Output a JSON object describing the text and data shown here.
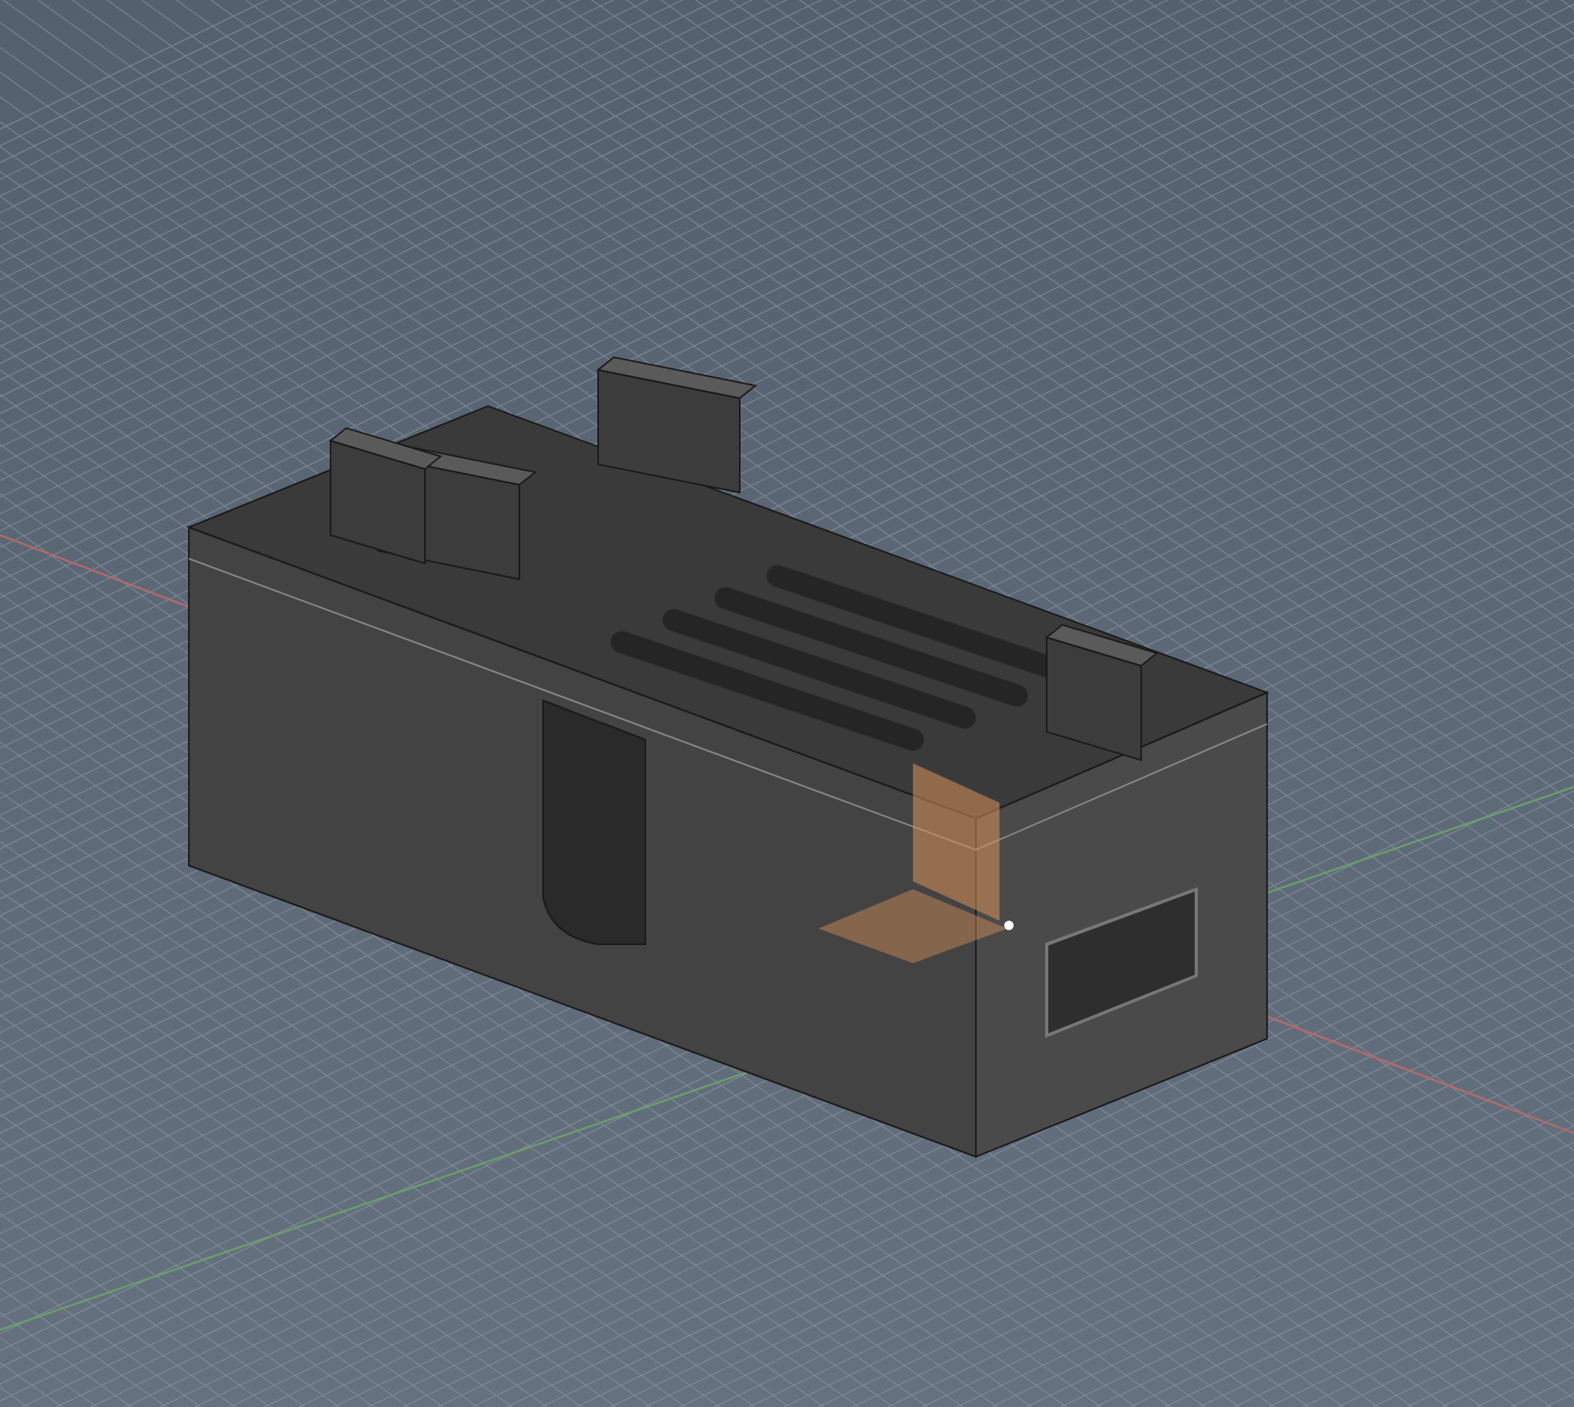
{
  "viewport": {
    "kind": "perspective",
    "grid": true,
    "axes": true
  },
  "model": {
    "kind": "enclosure",
    "origin_marker": true
  }
}
